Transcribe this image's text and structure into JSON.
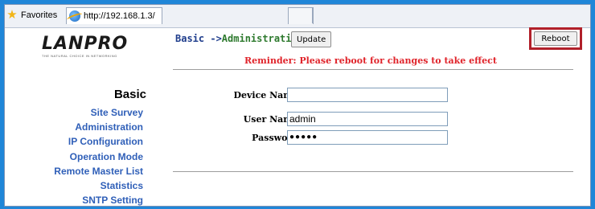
{
  "browser": {
    "favorites_label": "Favorites",
    "tab_url": "http://192.168.1.3/"
  },
  "logo": {
    "name": "LANPRO",
    "tagline": "THE NATURAL CHOICE IN NETWORKING"
  },
  "sidebar": {
    "heading": "Basic",
    "items": [
      {
        "label": "Site Survey"
      },
      {
        "label": "Administration"
      },
      {
        "label": "IP Configuration"
      },
      {
        "label": "Operation Mode"
      },
      {
        "label": "Remote Master List"
      },
      {
        "label": "Statistics"
      },
      {
        "label": "SNTP Setting"
      }
    ]
  },
  "header": {
    "crumb_basic": "Basic ->",
    "crumb_page": "Administration",
    "update_label": "Update",
    "reboot_label": "Reboot",
    "reminder": "Reminder: Please reboot for changes to take effect"
  },
  "form": {
    "device_name_label": "Device Name:",
    "device_name_value": "",
    "user_name_label": "User Name:",
    "user_name_value": "admin",
    "password_label": "Password:",
    "password_mask": "●●●●●"
  },
  "colors": {
    "nav_link": "#2f5fb8",
    "reminder": "#e0232a",
    "highlight_box": "#b1202a",
    "crumb_page": "#2e7a2e"
  }
}
